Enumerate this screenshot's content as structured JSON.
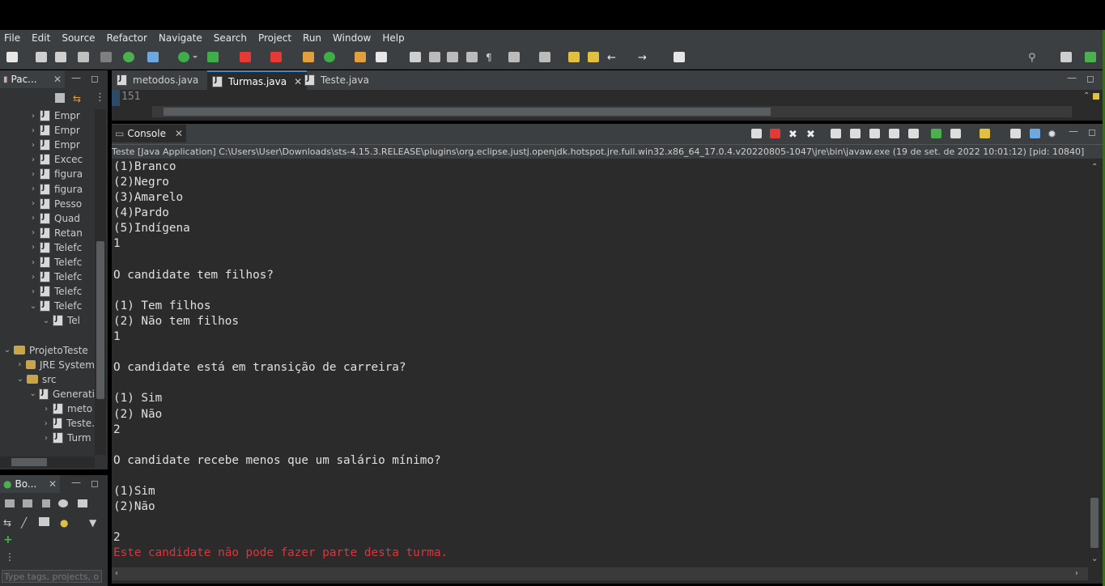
{
  "menu": [
    "File",
    "Edit",
    "Source",
    "Refactor",
    "Navigate",
    "Search",
    "Project",
    "Run",
    "Window",
    "Help"
  ],
  "package_explorer": {
    "tab_label": "Pac...",
    "items": [
      {
        "label": "Empr",
        "indent": 2,
        "chevron": "›"
      },
      {
        "label": "Empr",
        "indent": 2,
        "chevron": "›"
      },
      {
        "label": "Empr",
        "indent": 2,
        "chevron": "›"
      },
      {
        "label": "Excec",
        "indent": 2,
        "chevron": "›"
      },
      {
        "label": "figura",
        "indent": 2,
        "chevron": "›"
      },
      {
        "label": "figura",
        "indent": 2,
        "chevron": "›"
      },
      {
        "label": "Pesso",
        "indent": 2,
        "chevron": "›"
      },
      {
        "label": "Quad",
        "indent": 2,
        "chevron": "›"
      },
      {
        "label": "Retan",
        "indent": 2,
        "chevron": "›"
      },
      {
        "label": "Telefc",
        "indent": 2,
        "chevron": "›"
      },
      {
        "label": "Telefc",
        "indent": 2,
        "chevron": "›"
      },
      {
        "label": "Telefc",
        "indent": 2,
        "chevron": "›"
      },
      {
        "label": "Telefc",
        "indent": 2,
        "chevron": "›"
      },
      {
        "label": "Telefc",
        "indent": 2,
        "chevron": "⌄"
      },
      {
        "label": "Tel",
        "indent": 3,
        "chevron": "⌄"
      },
      {
        "label": "",
        "indent": 3,
        "chevron": ""
      },
      {
        "label": "ProjetoTeste",
        "indent": 0,
        "chevron": "⌄"
      },
      {
        "label": "JRE System",
        "indent": 1,
        "chevron": "›"
      },
      {
        "label": "src",
        "indent": 1,
        "chevron": "⌄"
      },
      {
        "label": "Generati",
        "indent": 2,
        "chevron": "⌄"
      },
      {
        "label": "meto",
        "indent": 3,
        "chevron": "›"
      },
      {
        "label": "Teste.",
        "indent": 3,
        "chevron": "›"
      },
      {
        "label": "Turm",
        "indent": 3,
        "chevron": "›"
      }
    ]
  },
  "boot_dashboard": {
    "tab_label": "Bo...",
    "filter_placeholder": "Type tags, projects, or"
  },
  "editor": {
    "tabs": [
      {
        "label": "metodos.java",
        "active": false
      },
      {
        "label": "Turmas.java",
        "active": true
      },
      {
        "label": "Teste.java",
        "active": false
      }
    ],
    "line_number": "151"
  },
  "console": {
    "tab_label": "Console",
    "description": "Teste [Java Application] C:\\Users\\User\\Downloads\\sts-4.15.3.RELEASE\\plugins\\org.eclipse.justj.openjdk.hotspot.jre.full.win32.x86_64_17.0.4.v20220805-1047\\jre\\bin\\javaw.exe  (19 de set. de 2022 10:01:12) [pid: 10840]",
    "lines": [
      "(1)Branco",
      "(2)Negro",
      "(3)Amarelo",
      "(4)Pardo",
      "(5)Indígena",
      "1",
      "",
      "O candidate tem filhos?",
      "",
      "(1) Tem filhos",
      "(2) Não tem filhos",
      "1",
      "",
      "O candidate está em transição de carreira?",
      "",
      "(1) Sim",
      "(2) Não",
      "2",
      "",
      "O candidate recebe menos que um salário mínimo?",
      "",
      "(1)Sim",
      "(2)Não",
      "",
      "2"
    ],
    "error_line": "Este candidate não pode fazer parte desta turma."
  },
  "colors": {
    "background": "#2b2b2b",
    "chrome": "#3c3f41",
    "error_text": "#d9363e",
    "active_tab_accent": "#4a88c7"
  }
}
